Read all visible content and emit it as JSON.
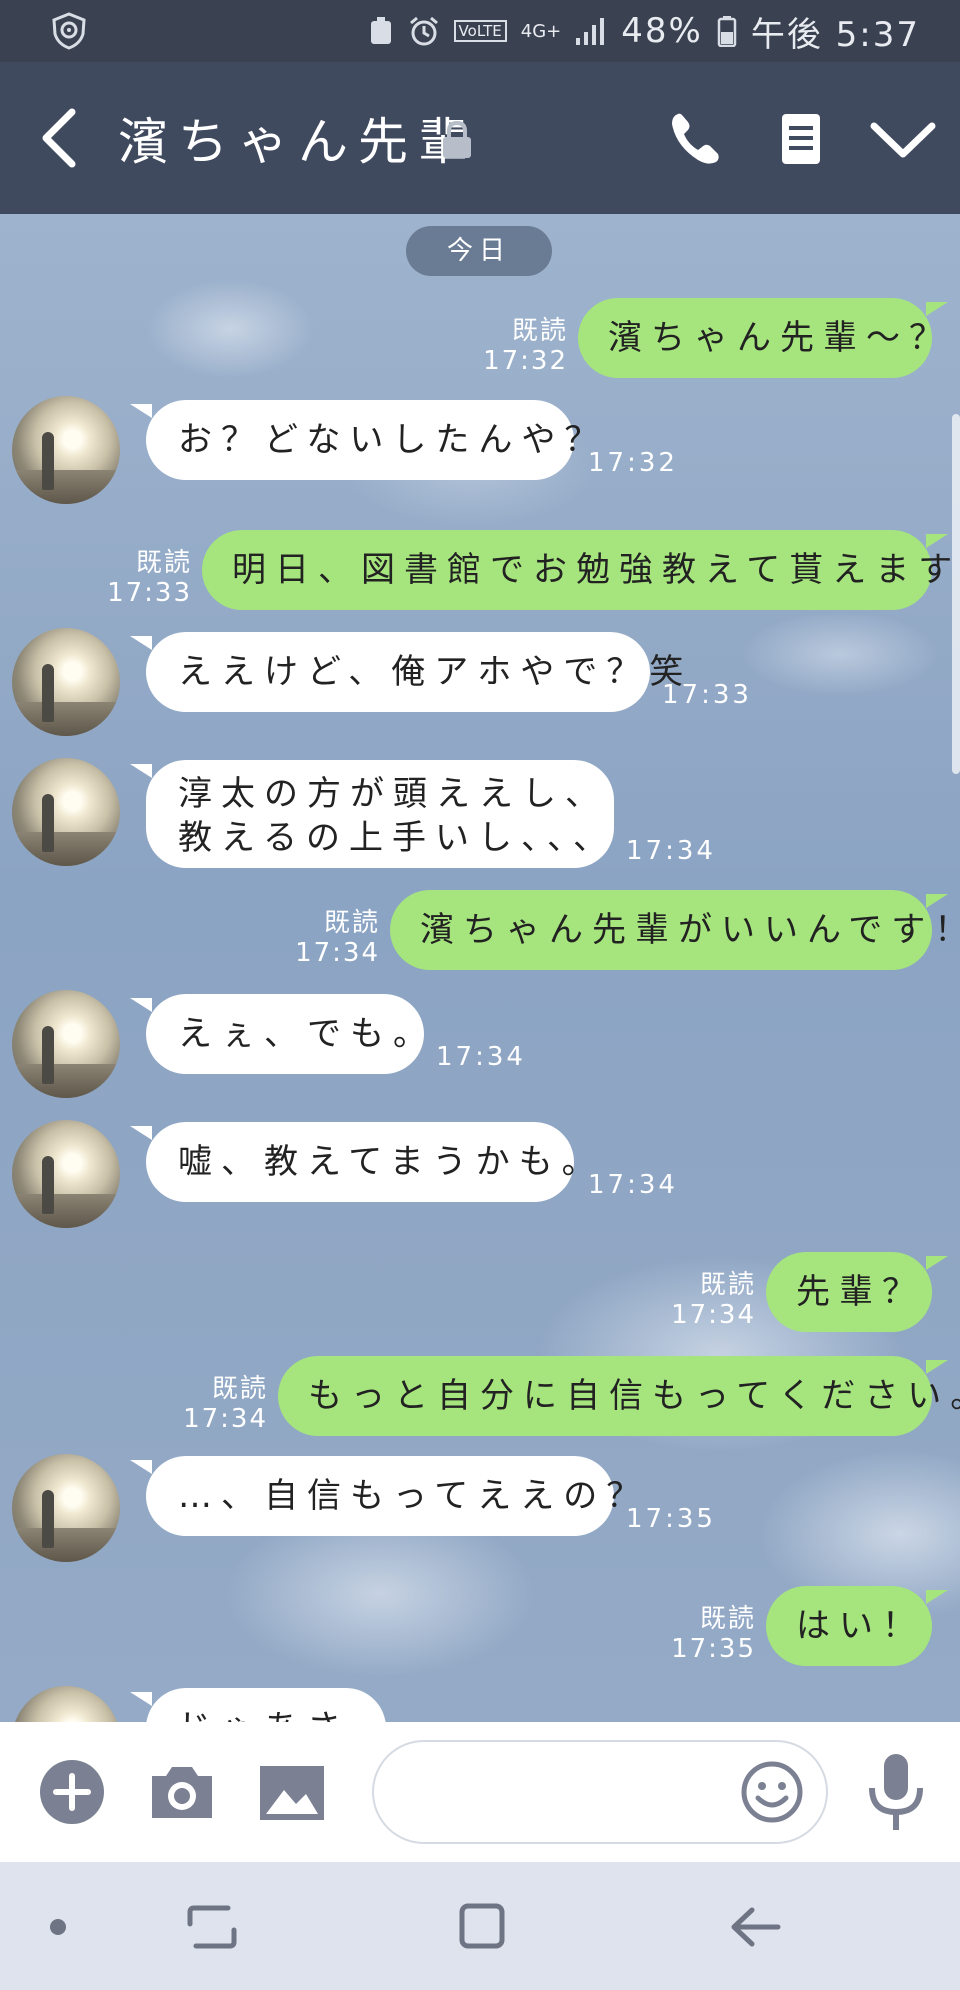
{
  "status_bar": {
    "signal": "4G+",
    "volte": "VoLTE",
    "battery": "48%",
    "time": "午後 5:37"
  },
  "header": {
    "title": "濱ちゃん先輩"
  },
  "chat": {
    "date_label": "今日",
    "messages": [
      {
        "side": "out",
        "text": "濱ちゃん先輩～？",
        "read": "既読",
        "time": "17:32"
      },
      {
        "side": "in",
        "text": "お？どないしたんや？",
        "time": "17:32"
      },
      {
        "side": "out",
        "text": "明日、図書館でお勉強教えて貰えます？",
        "read": "既読",
        "time": "17:33"
      },
      {
        "side": "in",
        "text": "ええけど、俺アホやで？笑",
        "time": "17:33"
      },
      {
        "side": "in",
        "text_line1": "淳太の方が頭ええし、",
        "text_line2": "教えるの上手いし、、、",
        "time": "17:34"
      },
      {
        "side": "out",
        "text": "濱ちゃん先輩がいいんです！",
        "read": "既読",
        "time": "17:34"
      },
      {
        "side": "in",
        "text": "えぇ、でも。",
        "time": "17:34"
      },
      {
        "side": "in",
        "text": "嘘、教えてまうかも。",
        "time": "17:34"
      },
      {
        "side": "out",
        "text": "先輩？",
        "read": "既読",
        "time": "17:34"
      },
      {
        "side": "out",
        "text": "もっと自分に自信もってください。",
        "read": "既読",
        "time": "17:34"
      },
      {
        "side": "in",
        "text": "…、自信もってええの？",
        "time": "17:35"
      },
      {
        "side": "out",
        "text": "はい！",
        "read": "既読",
        "time": "17:35"
      },
      {
        "side": "in",
        "text": "じゃあさ"
      }
    ]
  },
  "colors": {
    "header_bg": "#404a5f",
    "out_bubble": "#a6e57e",
    "in_bubble": "#ffffff",
    "icon_gray": "#7b8092"
  },
  "icons": {
    "back": "chevron-left-icon",
    "call": "phone-icon",
    "notes": "notes-icon",
    "menu": "chevron-down-icon",
    "add": "plus-circle-icon",
    "camera": "camera-icon",
    "gallery": "image-icon",
    "emoji": "smiley-icon",
    "mic": "microphone-icon"
  }
}
